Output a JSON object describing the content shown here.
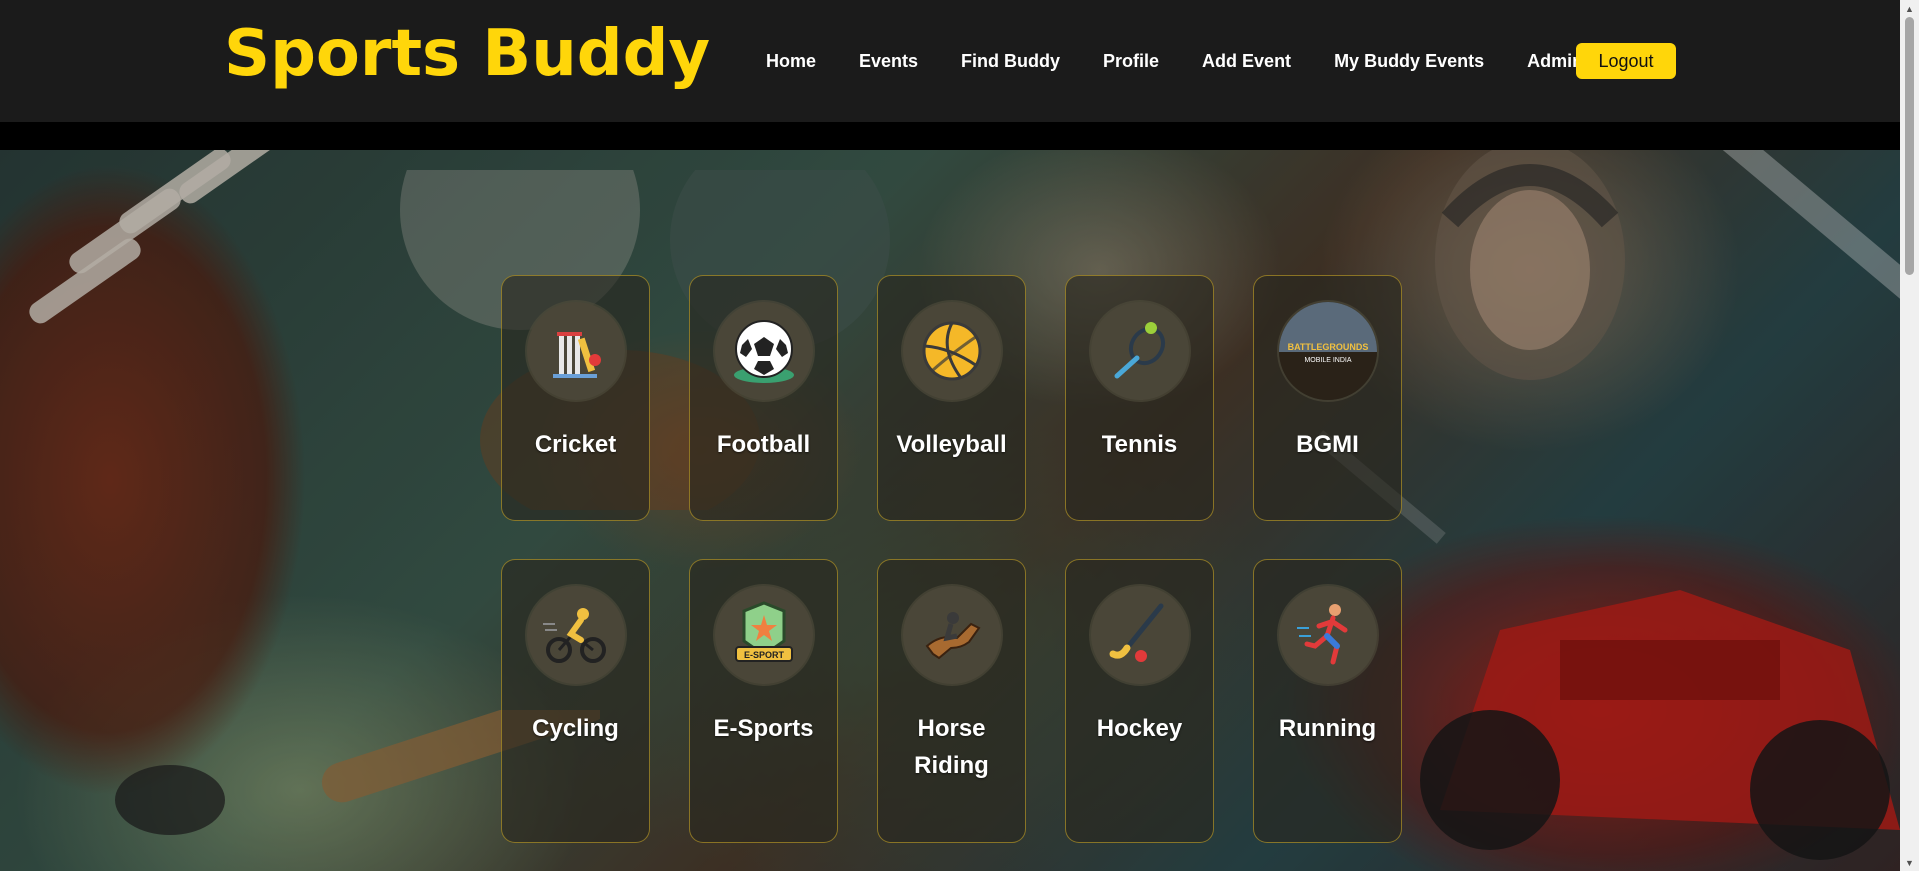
{
  "header": {
    "brand": "Sports Buddy",
    "nav": [
      "Home",
      "Events",
      "Find Buddy",
      "Profile",
      "Add Event",
      "My Buddy Events",
      "Admin"
    ],
    "logout_label": "Logout"
  },
  "sports": [
    {
      "label": "Cricket",
      "icon": "cricket-icon"
    },
    {
      "label": "Football",
      "icon": "football-icon"
    },
    {
      "label": "Volleyball",
      "icon": "volleyball-icon"
    },
    {
      "label": "Tennis",
      "icon": "tennis-icon"
    },
    {
      "label": "BGMI",
      "icon": "bgmi-icon",
      "icon_text": [
        "BATTLEGROUNDS",
        "MOBILE INDIA"
      ]
    },
    {
      "label": "Cycling",
      "icon": "cycling-icon"
    },
    {
      "label": "E-Sports",
      "icon": "esports-icon",
      "icon_text": [
        "E-SPORT"
      ]
    },
    {
      "label": "Horse Riding",
      "icon": "horse-riding-icon"
    },
    {
      "label": "Hockey",
      "icon": "hockey-icon"
    },
    {
      "label": "Running",
      "icon": "running-icon"
    }
  ],
  "colors": {
    "brand": "#ffd60a",
    "header_bg": "#1b1b1b",
    "card_border": "#d6b028"
  }
}
